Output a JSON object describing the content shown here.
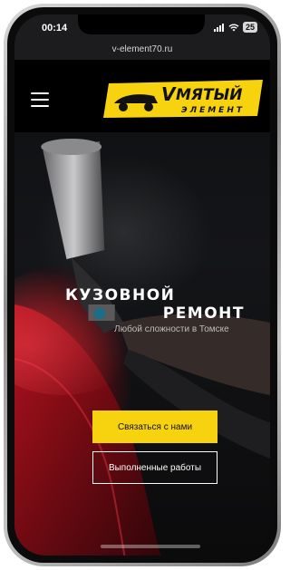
{
  "statusbar": {
    "time": "00:14",
    "signal": "signal-bars-icon",
    "wifi": "wifi-icon",
    "battery": "25"
  },
  "browser": {
    "url": "v-element70.ru"
  },
  "header": {
    "menu_icon": "hamburger-menu-icon",
    "logo_line1": "МЯТЫЙ",
    "logo_line2": "ЭЛЕМЕНТ",
    "logo_prefix": "V"
  },
  "hero": {
    "title_line1": "КУЗОВНОЙ",
    "title_line2": "РЕМОНТ",
    "subtitle": "Любой сложности в Томске"
  },
  "actions": {
    "primary_label": "Связаться с нами",
    "secondary_label": "Выполненные работы"
  },
  "colors": {
    "accent": "#f6d20f",
    "background": "#0d0d0e",
    "text": "#ffffff"
  }
}
